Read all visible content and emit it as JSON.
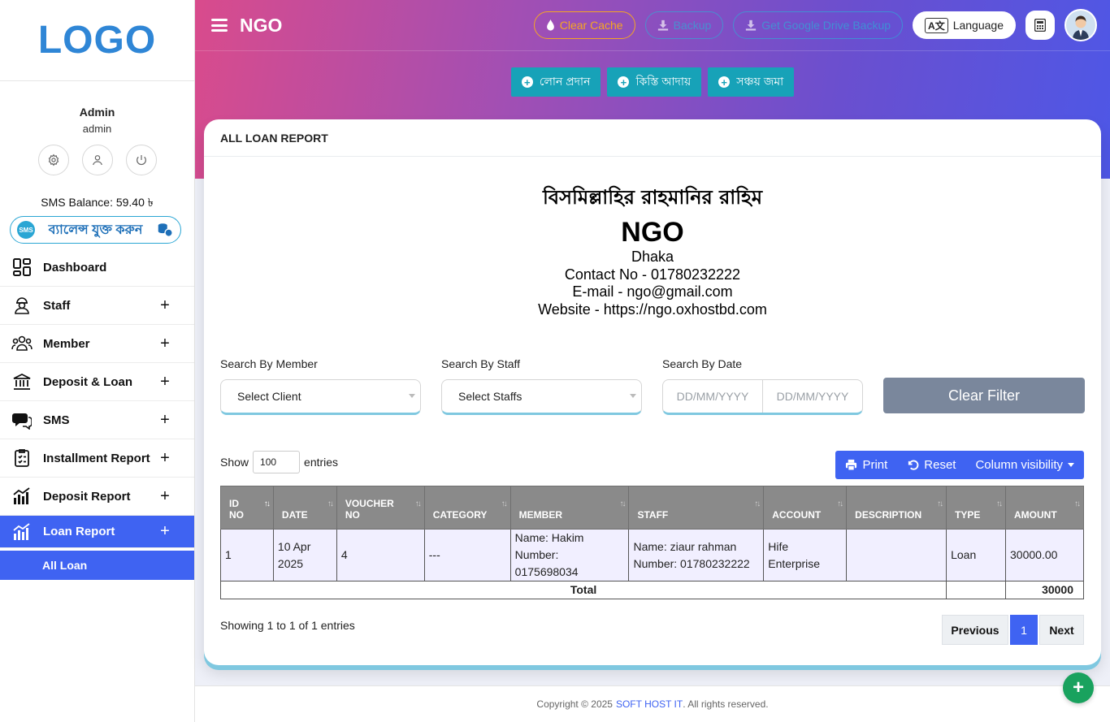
{
  "sidebar": {
    "logo": "LOGO",
    "user_name": "Admin",
    "user_role": "admin",
    "sms_balance": "SMS Balance: 59.40 ৳",
    "sms_add_label": "ব্যালেন্স যুক্ত করুন",
    "sms_tag": "SMS",
    "items": [
      {
        "label": "Dashboard"
      },
      {
        "label": "Staff",
        "expand": "+"
      },
      {
        "label": "Member",
        "expand": "+"
      },
      {
        "label": "Deposit & Loan",
        "expand": "+"
      },
      {
        "label": "SMS",
        "expand": "+"
      },
      {
        "label": "Installment Report",
        "expand": "+"
      },
      {
        "label": "Deposit Report",
        "expand": "+"
      },
      {
        "label": "Loan Report",
        "expand": "+"
      }
    ],
    "subitem": "All Loan"
  },
  "header": {
    "brand": "NGO",
    "clear_cache": "Clear Cache",
    "backup": "Backup",
    "drive_backup": "Get Google Drive Backup",
    "language": "Language",
    "lang_icon": "A文"
  },
  "actions": [
    "লোন প্রদান",
    "কিস্তি আদায়",
    "সঞ্চয় জমা"
  ],
  "card": {
    "title": "ALL LOAN REPORT",
    "bismillah": "বিসমিল্লাহির রাহমানির রাহিম",
    "org_name": "NGO",
    "address": "Dhaka",
    "contact": "Contact No - 01780232222",
    "email": "E-mail - ngo@gmail.com",
    "website": "Website - https://ngo.oxhostbd.com"
  },
  "filters": {
    "member_label": "Search By Member",
    "member_value": "Select Client",
    "staff_label": "Search By Staff",
    "staff_value": "Select Staffs",
    "date_label": "Search By Date",
    "date_from": "DD/MM/YYYY",
    "date_to": "DD/MM/YYYY",
    "clear": "Clear Filter"
  },
  "table_controls": {
    "show": "Show",
    "entries_value": "100",
    "entries": "entries",
    "print": "Print",
    "reset": "Reset",
    "column_visibility": "Column visibility"
  },
  "table": {
    "headers": [
      {
        "l1": "ID",
        "l2": "NO"
      },
      {
        "l1": "",
        "l2": "DATE"
      },
      {
        "l1": "VOUCHER",
        "l2": "NO"
      },
      {
        "l1": "",
        "l2": "CATEGORY"
      },
      {
        "l1": "",
        "l2": "MEMBER"
      },
      {
        "l1": "",
        "l2": "STAFF"
      },
      {
        "l1": "",
        "l2": "ACCOUNT"
      },
      {
        "l1": "",
        "l2": "DESCRIPTION"
      },
      {
        "l1": "",
        "l2": "TYPE"
      },
      {
        "l1": "",
        "l2": "AMOUNT"
      }
    ],
    "row": {
      "id": "1",
      "date": "10 Apr 2025",
      "voucher": "4",
      "category": "---",
      "member_name": "Name: Hakim",
      "member_number": "Number: 0175698034",
      "staff_name": "Name: ziaur rahman",
      "staff_number": "Number: 01780232222",
      "account": "Hife Enterprise",
      "description": "",
      "type": "Loan",
      "amount": "30000.00"
    },
    "total_label": "Total",
    "total_amount": "30000"
  },
  "pagination": {
    "info": "Showing 1 to 1 of 1 entries",
    "previous": "Previous",
    "current": "1",
    "next": "Next"
  },
  "footer": {
    "prefix": "Copyright © 2025",
    "company": "SOFT HOST IT",
    "suffix": ". All rights reserved."
  },
  "colors": {
    "primary": "#3f63f2",
    "teal": "#17a2b8",
    "warning": "#f5a623",
    "success": "#19a25e"
  }
}
